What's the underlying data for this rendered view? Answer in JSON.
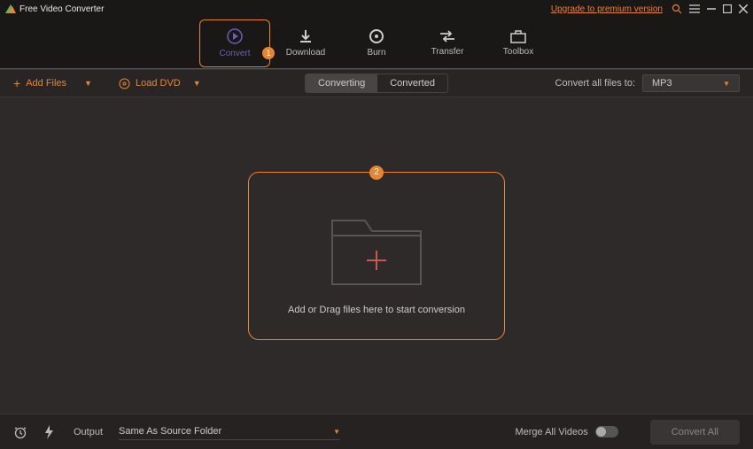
{
  "app": {
    "title": "Free Video Converter",
    "upgrade": "Upgrade to premium version"
  },
  "nav": {
    "items": [
      {
        "label": "Convert",
        "marker": "1"
      },
      {
        "label": "Download"
      },
      {
        "label": "Burn"
      },
      {
        "label": "Transfer"
      },
      {
        "label": "Toolbox"
      }
    ]
  },
  "toolbar": {
    "add_files": "Add Files",
    "load_dvd": "Load DVD",
    "tab_converting": "Converting",
    "tab_converted": "Converted",
    "convert_all_label": "Convert all files to:",
    "format": "MP3"
  },
  "dropzone": {
    "marker": "2",
    "hint": "Add or Drag files here to start conversion"
  },
  "footer": {
    "output_label": "Output",
    "output_value": "Same As Source Folder",
    "merge_label": "Merge All Videos",
    "convert_all": "Convert All"
  }
}
